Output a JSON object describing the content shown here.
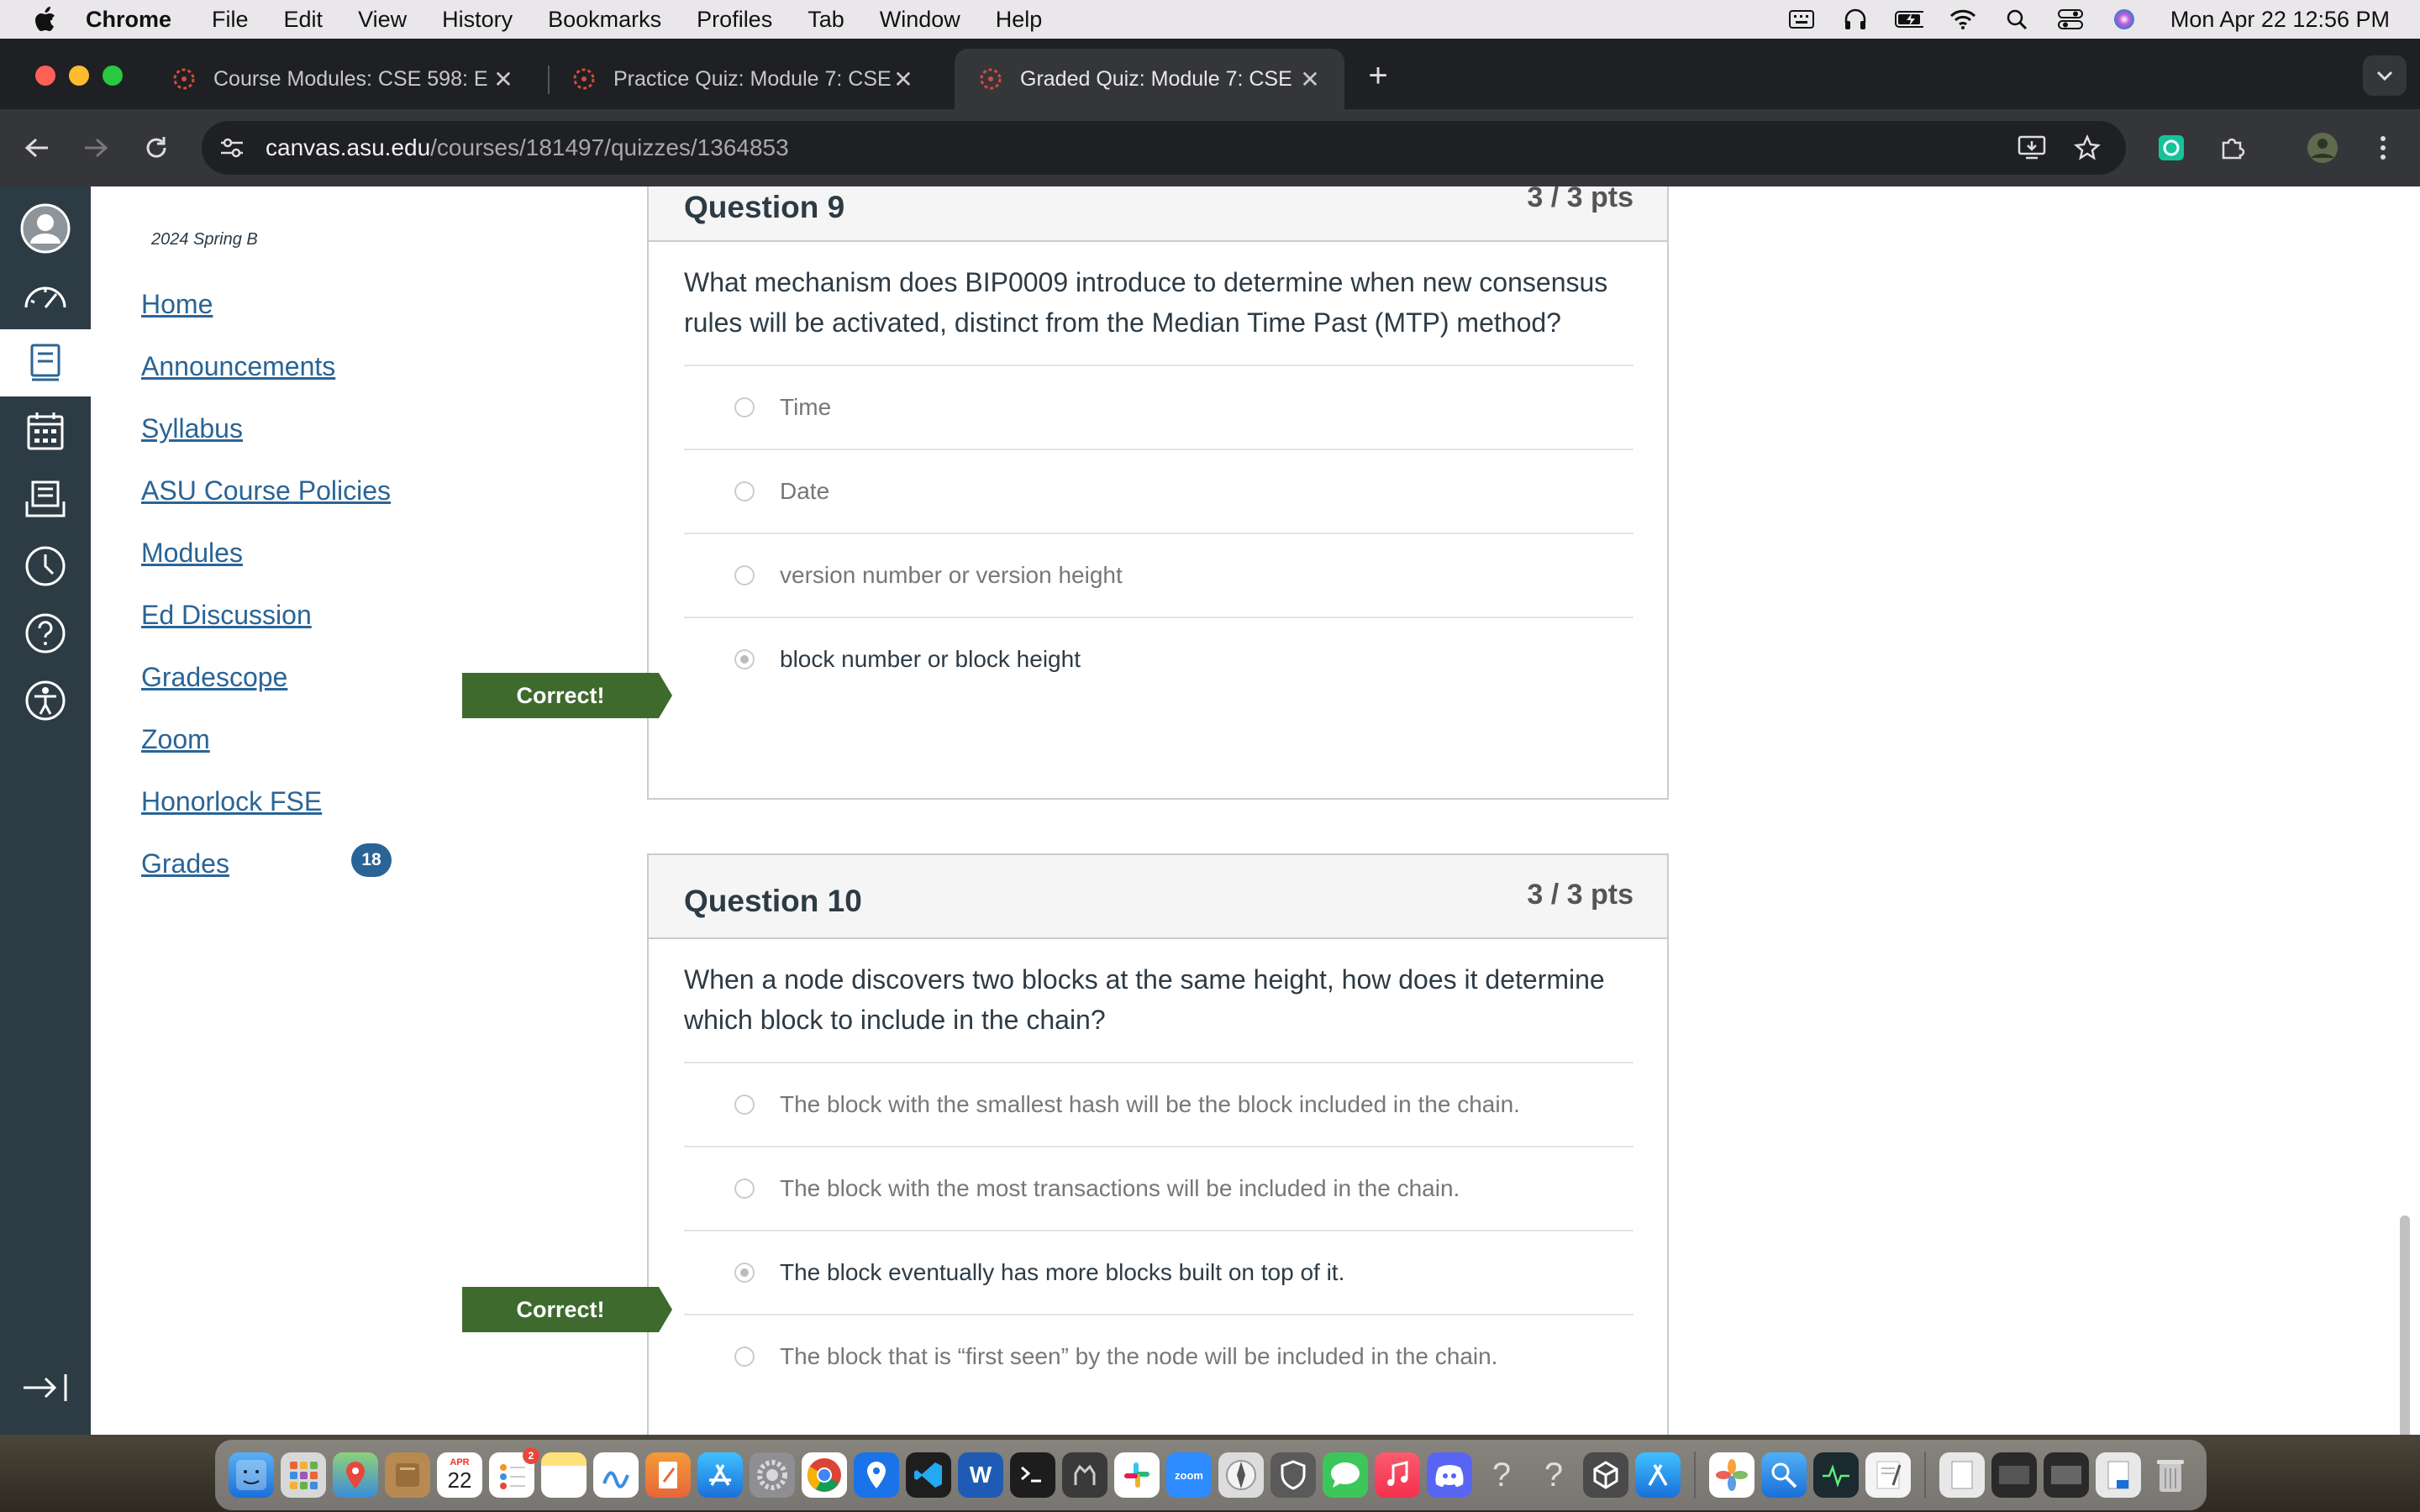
{
  "menubar": {
    "app_name": "Chrome",
    "items": [
      "File",
      "Edit",
      "View",
      "History",
      "Bookmarks",
      "Profiles",
      "Tab",
      "Window",
      "Help"
    ],
    "clock": "Mon Apr 22  12:56 PM"
  },
  "browser": {
    "tabs": [
      {
        "title": "Course Modules: CSE 598: E",
        "active": false
      },
      {
        "title": "Practice Quiz: Module 7: CSE",
        "active": false
      },
      {
        "title": "Graded Quiz: Module 7: CSE",
        "active": true
      }
    ],
    "url_host": "canvas.asu.edu",
    "url_path": "/courses/181497/quizzes/1364853"
  },
  "course_nav": {
    "term": "2024 Spring B",
    "links": [
      "Home",
      "Announcements",
      "Syllabus",
      "ASU Course Policies",
      "Modules",
      "Ed Discussion",
      "Gradescope",
      "Zoom",
      "Honorlock FSE",
      "Grades"
    ],
    "grades_badge": "18"
  },
  "questions": [
    {
      "title": "Question 9",
      "points": "3 / 3 pts",
      "text": "What mechanism does BIP0009 introduce to determine when new consensus rules will be activated, distinct from the Median Time Past (MTP) method?",
      "answers": [
        "Time",
        "Date",
        "version number or version height",
        "block number or block height"
      ],
      "selected_index": 3,
      "flag": "Correct!"
    },
    {
      "title": "Question 10",
      "points": "3 / 3 pts",
      "text": "When a node discovers two blocks at the same height, how does it determine which block to include in the chain?",
      "answers": [
        "The block with the smallest hash will be the block included in the chain.",
        "The block with the most transactions will be included in the chain.",
        "The block eventually has more blocks built on top of it.",
        "The block that is “first seen” by the node will be included in the chain."
      ],
      "selected_index": 2,
      "flag": "Correct!"
    }
  ],
  "dock": {
    "calendar_day": "22",
    "calendar_month": "APR",
    "reminders_badge": "2",
    "zoom_label": "zoom",
    "word_label": "W"
  },
  "colors": {
    "canvas_nav": "#2d3b45",
    "link": "#2a6496",
    "correct": "#3e6a2e"
  }
}
